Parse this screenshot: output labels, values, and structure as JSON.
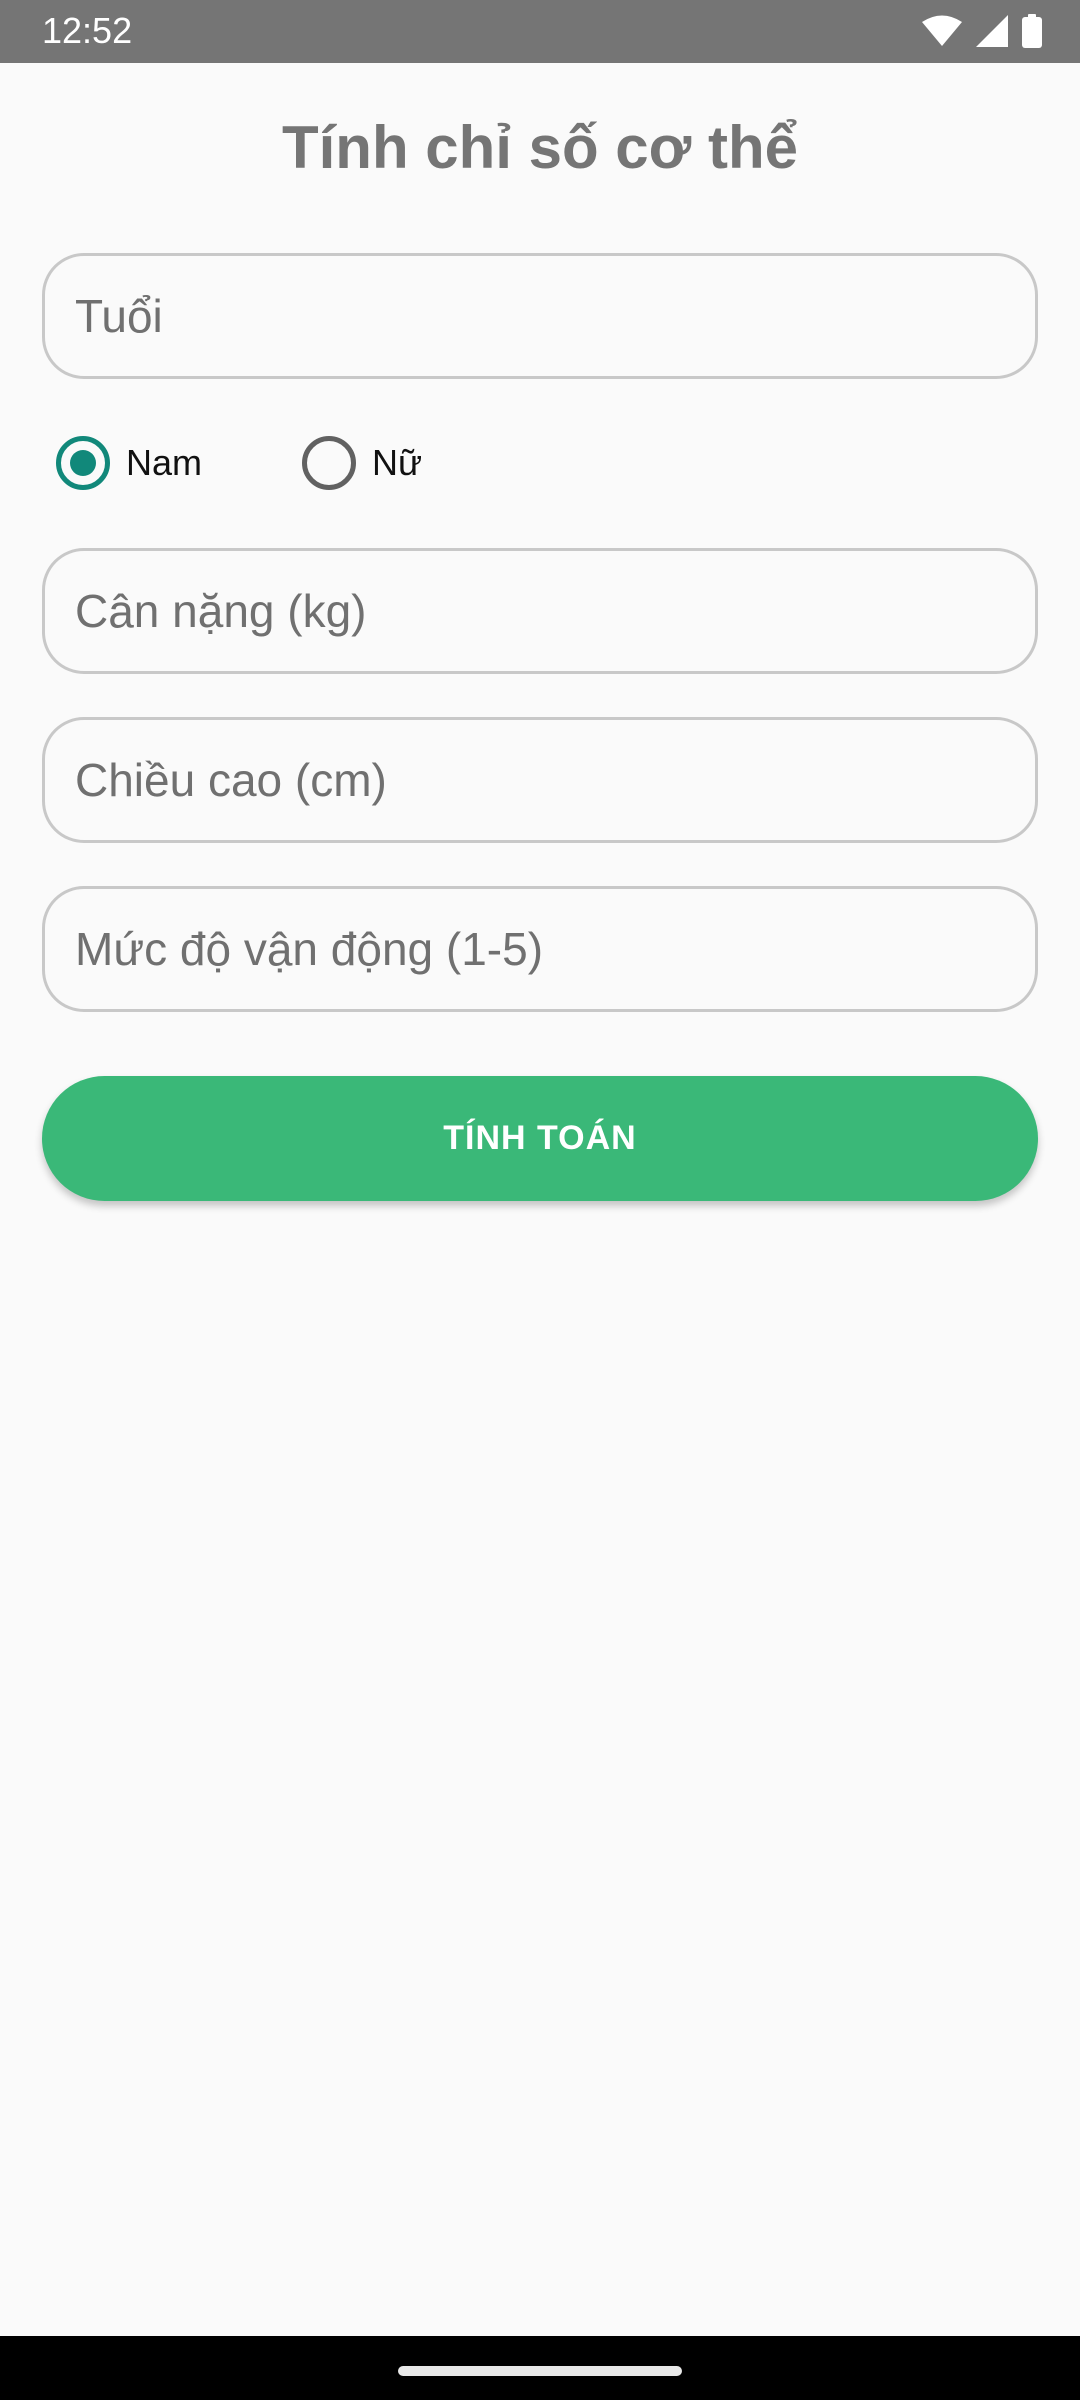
{
  "status_bar": {
    "time": "12:52",
    "icons": [
      "wifi-icon",
      "signal-icon",
      "battery-icon"
    ]
  },
  "title": "Tính chỉ số cơ thể",
  "fields": {
    "age_placeholder": "Tuổi",
    "weight_placeholder": "Cân nặng (kg)",
    "height_placeholder": "Chiều cao (cm)",
    "activity_placeholder": "Mức độ vận động (1-5)"
  },
  "gender": {
    "male_label": "Nam",
    "female_label": "Nữ",
    "selected": "Nam"
  },
  "button": {
    "calculate_label": "TÍNH TOÁN"
  },
  "colors": {
    "accent": "#11887a",
    "button": "#3ab878",
    "status_bar": "#757575",
    "background": "#fafafa"
  }
}
